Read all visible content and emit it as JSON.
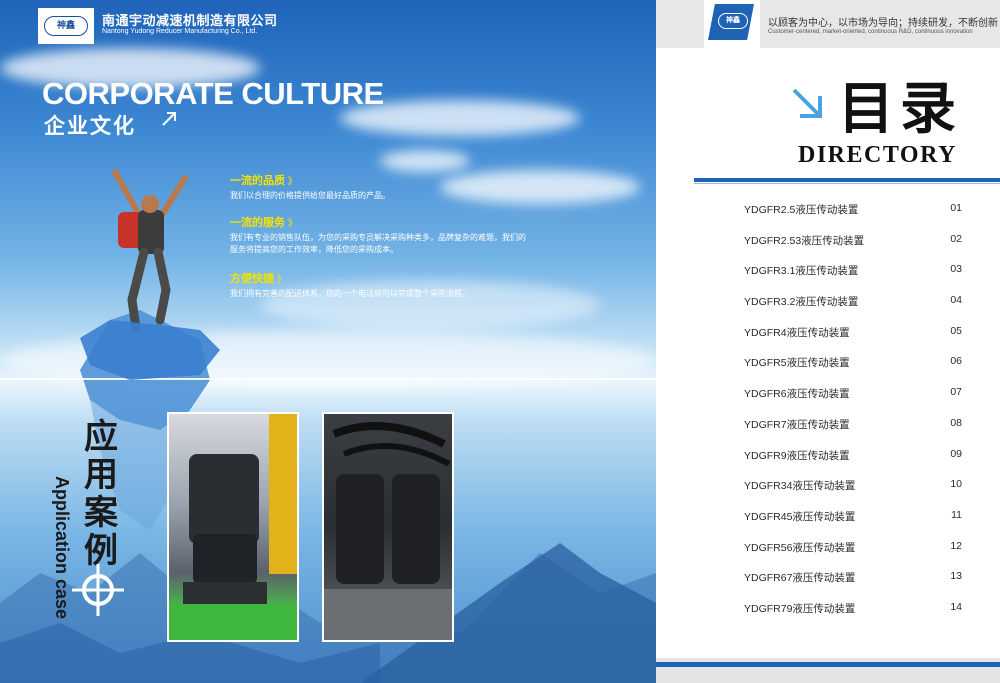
{
  "left": {
    "company_cn": "南通宇动减速机制造有限公司",
    "company_en": "Nantong Yudong Reducer Manufacturing Co., Ltd.",
    "logo_text": "神鑫",
    "culture_en": "CORPORATE CULTURE",
    "culture_cn": "企业文化",
    "features": [
      {
        "title": "一流的品质",
        "desc": "我们以合理的价格提供给您最好品质的产品。"
      },
      {
        "title": "一流的服务",
        "desc": "我们有专业的销售队伍，为您的采购专员解决采购种类多，品牌复杂的难题，我们的服务将提高您的工作效率，降低您的采购成本。"
      },
      {
        "title": "方便快捷",
        "desc": "我们拥有完善的配送体系，您的一个电话就可以完成整个采购流程。"
      }
    ],
    "feature_chevron": "》",
    "application_cn": "应用案例",
    "application_en": "Application case"
  },
  "right": {
    "logo_text": "神鑫",
    "slogan_cn": "以顾客为中心，以市场为导向；持续研发，不断创新",
    "slogan_en": "Customer-centered, market-oriented, continuous R&D, continuous innovation",
    "directory_cn": "目录",
    "directory_en": "DIRECTORY",
    "toc": [
      {
        "name": "YDGFR2.5液压传动装置",
        "page": "01"
      },
      {
        "name": "YDGFR2.53液压传动装置",
        "page": "02"
      },
      {
        "name": "YDGFR3.1液压传动装置",
        "page": "03"
      },
      {
        "name": "YDGFR3.2液压传动装置",
        "page": "04"
      },
      {
        "name": "YDGFR4液压传动装置",
        "page": "05"
      },
      {
        "name": "YDGFR5液压传动装置",
        "page": "06"
      },
      {
        "name": "YDGFR6液压传动装置",
        "page": "07"
      },
      {
        "name": "YDGFR7液压传动装置",
        "page": "08"
      },
      {
        "name": "YDGFR9液压传动装置",
        "page": "09"
      },
      {
        "name": "YDGFR34液压传动装置",
        "page": "10"
      },
      {
        "name": "YDGFR45液压传动装置",
        "page": "11"
      },
      {
        "name": "YDGFR56液压传动装置",
        "page": "12"
      },
      {
        "name": "YDGFR67液压传动装置",
        "page": "13"
      },
      {
        "name": "YDGFR79液压传动装置",
        "page": "14"
      }
    ]
  },
  "colors": {
    "accent_blue": "#1f63b5",
    "feature_yellow": "#f2e200"
  }
}
